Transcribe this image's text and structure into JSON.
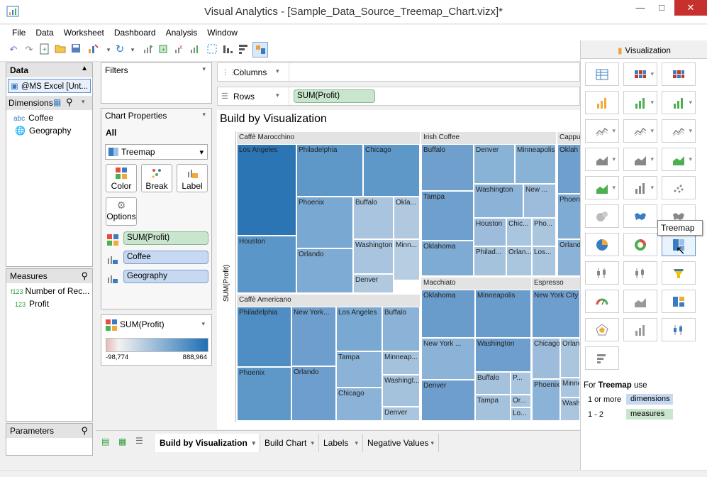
{
  "window": {
    "title": "Visual Analytics - [Sample_Data_Source_Treemap_Chart.vizx]*",
    "minimize": "—",
    "maximize": "□",
    "close": "✕"
  },
  "menu": [
    "File",
    "Data",
    "Worksheet",
    "Dashboard",
    "Analysis",
    "Window"
  ],
  "data_panel": {
    "title": "Data",
    "source": "@MS Excel [Unt...",
    "dimensions_label": "Dimensions",
    "dimensions": [
      {
        "type": "abc",
        "name": "Coffee"
      },
      {
        "type": "globe-icon",
        "name": "Geography"
      }
    ],
    "measures_label": "Measures",
    "measures": [
      {
        "type": "f123",
        "name": "Number of Rec..."
      },
      {
        "type": "123",
        "name": "Profit"
      }
    ],
    "parameters_label": "Parameters"
  },
  "filters_label": "Filters",
  "chart_properties": {
    "title": "Chart Properties",
    "all_label": "All",
    "chart_type": "Treemap",
    "marks": [
      {
        "label": "Color"
      },
      {
        "label": "Break"
      },
      {
        "label": "Label"
      },
      {
        "label": "Options"
      }
    ],
    "fields": [
      {
        "name": "SUM(Profit)",
        "kind": "green"
      },
      {
        "name": "Coffee",
        "kind": "blue"
      },
      {
        "name": "Geography",
        "kind": "blue"
      }
    ]
  },
  "legend": {
    "title": "SUM(Profit)",
    "min": "-98,774",
    "max": "888,964",
    "colors": [
      "#e8b9b9",
      "#f2f2f2",
      "#1f6fb5"
    ]
  },
  "shelves": {
    "columns_label": "Columns",
    "rows_label": "Rows",
    "rows_pill": "SUM(Profit)"
  },
  "viz": {
    "title": "Build by Visualization",
    "axis_label": "SUM(Profit)"
  },
  "treemap": {
    "groups": [
      {
        "name": "Caffè Marocchino",
        "cells": [
          {
            "label": "Los Angeles",
            "shade": "#2c75b5"
          },
          {
            "label": "Philadelphia",
            "shade": "#5e98c9"
          },
          {
            "label": "Chicago",
            "shade": "#5e98c9"
          },
          {
            "label": "Phoenix",
            "shade": "#79a9d2"
          },
          {
            "label": "Buffalo",
            "shade": "#a8c4de"
          },
          {
            "label": "Okla...",
            "shade": "#b0c9df"
          },
          {
            "label": "Houston",
            "shade": "#5b96c8"
          },
          {
            "label": "Washington",
            "shade": "#a8c4de"
          },
          {
            "label": "Minn...",
            "shade": "#b7cee2"
          },
          {
            "label": "Orlando",
            "shade": "#7eabd3"
          },
          {
            "label": "Denver",
            "shade": "#b0c9df"
          }
        ]
      },
      {
        "name": "Irish Coffee",
        "cells": [
          {
            "label": "Buffalo",
            "shade": "#6f9fcd"
          },
          {
            "label": "Denver",
            "shade": "#89b2d7"
          },
          {
            "label": "Minneapolis",
            "shade": "#89b2d7"
          },
          {
            "label": "Washington",
            "shade": "#8bb3d7"
          },
          {
            "label": "New ...",
            "shade": "#9dbcdb"
          },
          {
            "label": "Tampa",
            "shade": "#6f9fcd"
          },
          {
            "label": "Houston",
            "shade": "#9dbcdb"
          },
          {
            "label": "Chic...",
            "shade": "#aac6df"
          },
          {
            "label": "Pho...",
            "shade": "#aac6df"
          },
          {
            "label": "Oklahoma",
            "shade": "#7eabd3"
          },
          {
            "label": "Philad...",
            "shade": "#a5c2dd"
          },
          {
            "label": "Orlan...",
            "shade": "#aac6df"
          },
          {
            "label": "Los...",
            "shade": "#aac6df"
          }
        ]
      },
      {
        "name": "Cappu",
        "cells": [
          {
            "label": "Oklah",
            "shade": "#6f9fcd"
          },
          {
            "label": "Phoen",
            "shade": "#7eabd3"
          },
          {
            "label": "Orland",
            "shade": "#8bb3d7"
          }
        ]
      },
      {
        "name": "Caffè Americano",
        "cells": [
          {
            "label": "Philadelphia",
            "shade": "#4f8ec4"
          },
          {
            "label": "New York...",
            "shade": "#6e9ecd"
          },
          {
            "label": "Los Angeles",
            "shade": "#79a9d2"
          },
          {
            "label": "Buffalo",
            "shade": "#8bb3d7"
          },
          {
            "label": "Phoenix",
            "shade": "#5e98c9"
          },
          {
            "label": "Orlando",
            "shade": "#6e9ecd"
          },
          {
            "label": "Tampa",
            "shade": "#8bb3d7"
          },
          {
            "label": "Minneap...",
            "shade": "#a5c2dd"
          },
          {
            "label": "Washingt...",
            "shade": "#a5c2dd"
          },
          {
            "label": "Chicago",
            "shade": "#8bb3d7"
          },
          {
            "label": "Denver",
            "shade": "#aac6df"
          }
        ]
      },
      {
        "name": "Macchiato",
        "cells": [
          {
            "label": "Oklahoma",
            "shade": "#6a9ccb"
          },
          {
            "label": "Minneapolis",
            "shade": "#6a9ccb"
          },
          {
            "label": "Washington",
            "shade": "#6e9ecd"
          },
          {
            "label": "New York ...",
            "shade": "#8bb3d7"
          },
          {
            "label": "Buffalo",
            "shade": "#a5c2dd"
          },
          {
            "label": "P...",
            "shade": "#aac6df"
          },
          {
            "label": "Denver",
            "shade": "#6e9ecd"
          },
          {
            "label": "Tampa",
            "shade": "#a5c2dd"
          },
          {
            "label": "Or...",
            "shade": "#aac6df"
          },
          {
            "label": "Lo...",
            "shade": "#aac6df"
          }
        ]
      },
      {
        "name": "Espresso",
        "cells": [
          {
            "label": "New York City",
            "shade": "#6e9ecd"
          },
          {
            "label": "Chicago",
            "shade": "#9dbcdb"
          },
          {
            "label": "Orlan",
            "shade": "#aac6df"
          },
          {
            "label": "Phoenix",
            "shade": "#8bb3d7"
          },
          {
            "label": "Minne",
            "shade": "#aac6df"
          },
          {
            "label": "Wash",
            "shade": "#aac6df"
          }
        ]
      }
    ]
  },
  "viz_panel": {
    "title": "Visualization",
    "tooltip": "Treemap",
    "hint_prefix": "For",
    "hint_type": "Treemap",
    "hint_suffix": "use",
    "req": [
      {
        "count": "1 or more",
        "kind": "dimensions"
      },
      {
        "count": "1 - 2",
        "kind": "measures"
      }
    ]
  },
  "tabs": [
    "Build by Visualization",
    "Build Chart",
    "Labels",
    "Negative Values"
  ],
  "dd_arrow": "▾",
  "pill_arrow": "▾",
  "bar_arrow": "▾"
}
